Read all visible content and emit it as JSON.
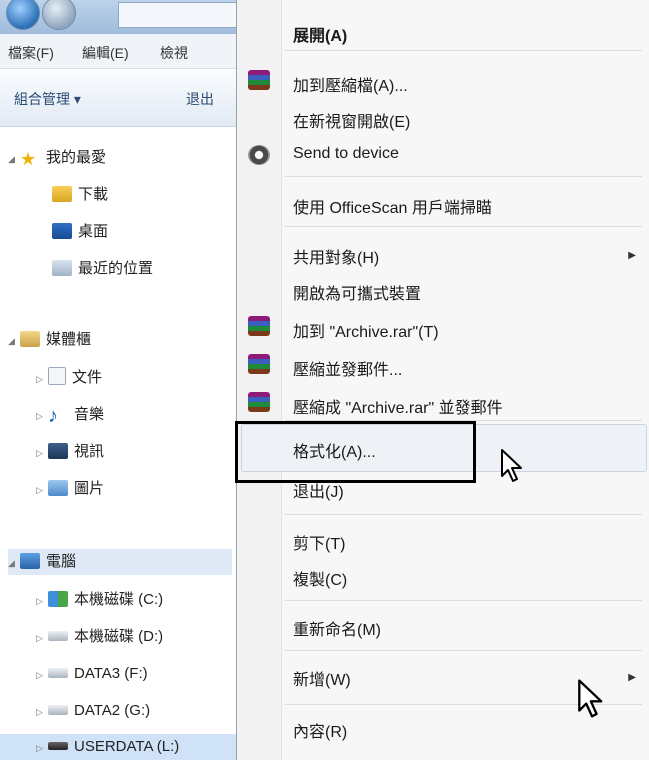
{
  "explorer": {
    "menubar": {
      "file": "檔案(F)",
      "edit": "編輯(E)",
      "view": "檢視"
    },
    "toolbar": {
      "organize": "組合管理 ▾",
      "eject": "退出"
    },
    "nav": {
      "favorites": "我的最愛",
      "downloads": "下載",
      "desktop": "桌面",
      "recent": "最近的位置",
      "libraries": "媒體櫃",
      "documents": "文件",
      "music": "音樂",
      "videos": "視訊",
      "pictures": "圖片",
      "computer": "電腦",
      "drive_c": "本機磁碟 (C:)",
      "drive_d": "本機磁碟 (D:)",
      "drive_f": "DATA3 (F:)",
      "drive_g": "DATA2 (G:)",
      "drive_l": "USERDATA (L:)"
    }
  },
  "context_menu": {
    "expand": "展開(A)",
    "add_to_archive": "加到壓縮檔(A)...",
    "open_new_window": "在新視窗開啟(E)",
    "send_to_device": "Send to device",
    "officescan": "使用 OfficeScan 用戶端掃瞄",
    "share_with": "共用對象(H)",
    "open_portable": "開啟為可攜式裝置",
    "add_to_rar": "加到 \"Archive.rar\"(T)",
    "compress_email": "壓縮並發郵件...",
    "compress_rar_email": "壓縮成 \"Archive.rar\" 並發郵件",
    "format": "格式化(A)...",
    "eject": "退出(J)",
    "cut": "剪下(T)",
    "copy": "複製(C)",
    "rename": "重新命名(M)",
    "new": "新增(W)",
    "properties": "內容(R)"
  }
}
